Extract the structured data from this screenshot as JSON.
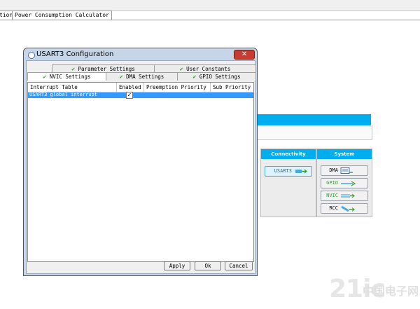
{
  "tabs": [
    {
      "label": "tion"
    },
    {
      "label": "Power Consumption Calculator"
    }
  ],
  "connectivity": {
    "header": "Connectivity",
    "buttons": [
      {
        "label": "USART3"
      }
    ]
  },
  "system": {
    "header": "System",
    "buttons": [
      {
        "label": "DMA"
      },
      {
        "label": "GPIO"
      },
      {
        "label": "NVIC"
      },
      {
        "label": "RCC"
      }
    ]
  },
  "dialog": {
    "title": "USART3 Configuration",
    "close_glyph": "✕",
    "tabs_row1": [
      {
        "label": "Parameter Settings"
      },
      {
        "label": "User Constants"
      }
    ],
    "tabs_row2": [
      {
        "label": "NVIC Settings",
        "active": true
      },
      {
        "label": "DMA Settings"
      },
      {
        "label": "GPIO Settings"
      }
    ],
    "check_glyph": "✔",
    "table": {
      "columns": [
        "Interrupt Table",
        "Enabled",
        "Preemption Priority",
        "Sub Priority"
      ],
      "rows": [
        {
          "name": "USART3 global interrupt",
          "enabled": "✓",
          "preemption": "",
          "sub": ""
        }
      ]
    },
    "buttons": {
      "apply": "Apply",
      "ok": "Ok",
      "cancel": "Cancel"
    }
  },
  "watermark": {
    "text": "21ic",
    "suffix": "中国电子网"
  },
  "colors": {
    "accent": "#00aeef",
    "selection": "#3399ff",
    "check": "#2aa12a"
  }
}
